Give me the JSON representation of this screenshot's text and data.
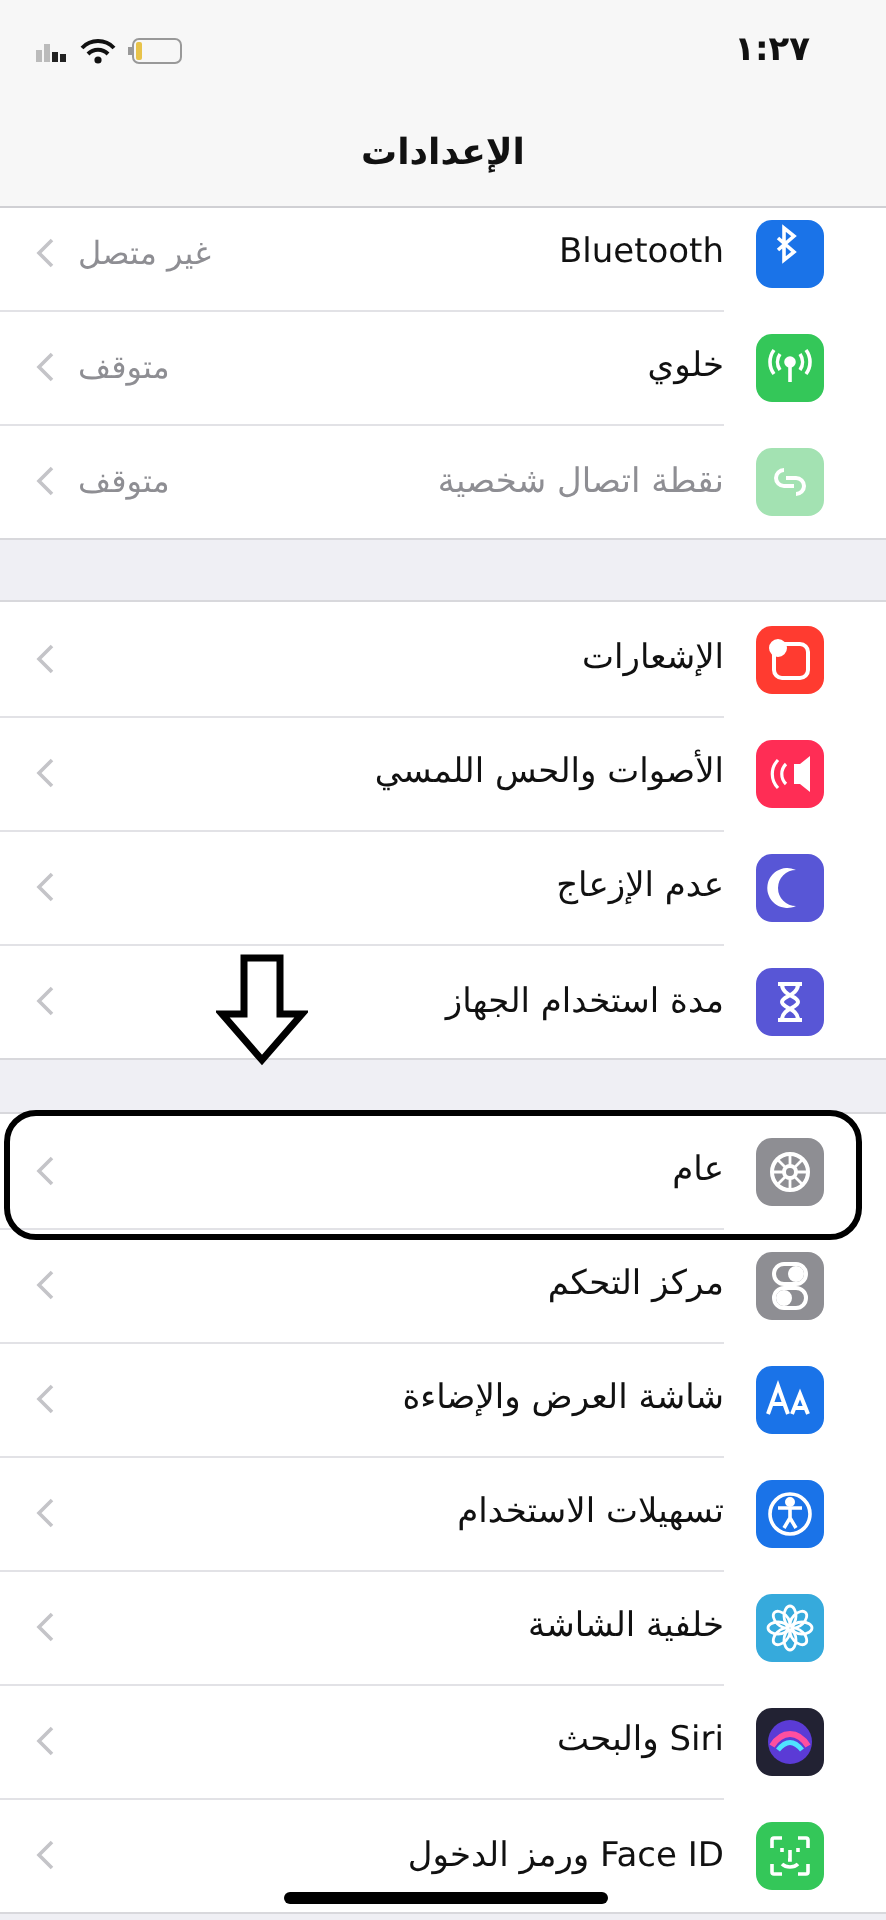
{
  "status_bar": {
    "time": "١:٢٧"
  },
  "title": "الإعدادات",
  "groups": [
    {
      "rows": [
        {
          "label": "Bluetooth",
          "value": "غير متصل",
          "disabled": false,
          "circled": false,
          "color": "#1a73e8"
        },
        {
          "label": "خلوي",
          "value": "متوقف",
          "disabled": false,
          "circled": false,
          "color": "#34c759"
        },
        {
          "label": "نقطة اتصال شخصية",
          "value": "متوقف",
          "disabled": true,
          "circled": false,
          "color": "#a3e2b2"
        }
      ]
    },
    {
      "rows": [
        {
          "label": "الإشعارات",
          "disabled": false,
          "circled": false,
          "color": "#ff3b30"
        },
        {
          "label": "الأصوات والحس اللمسي",
          "disabled": false,
          "circled": false,
          "color": "#ff2d55"
        },
        {
          "label": "عدم الإزعاج",
          "disabled": false,
          "circled": false,
          "color": "#5856d6"
        },
        {
          "label": "مدة استخدام الجهاز",
          "disabled": false,
          "circled": false,
          "color": "#5856d6"
        }
      ]
    },
    {
      "rows": [
        {
          "label": "عام",
          "disabled": false,
          "circled": true,
          "color": "#8e8e93"
        },
        {
          "label": "مركز التحكم",
          "disabled": false,
          "circled": false,
          "color": "#8e8e93"
        },
        {
          "label": "شاشة العرض والإضاءة",
          "disabled": false,
          "circled": false,
          "color": "#1a73e8"
        },
        {
          "label": "تسهيلات الاستخدام",
          "disabled": false,
          "circled": false,
          "color": "#1a73e8"
        },
        {
          "label": "خلفية الشاشة",
          "disabled": false,
          "circled": false,
          "color": "#36aadc"
        },
        {
          "label": "Siri والبحث",
          "disabled": false,
          "circled": false,
          "color": "#222233"
        },
        {
          "label": "Face ID ورمز الدخول",
          "disabled": false,
          "circled": false,
          "color": "#34c759"
        }
      ]
    }
  ]
}
